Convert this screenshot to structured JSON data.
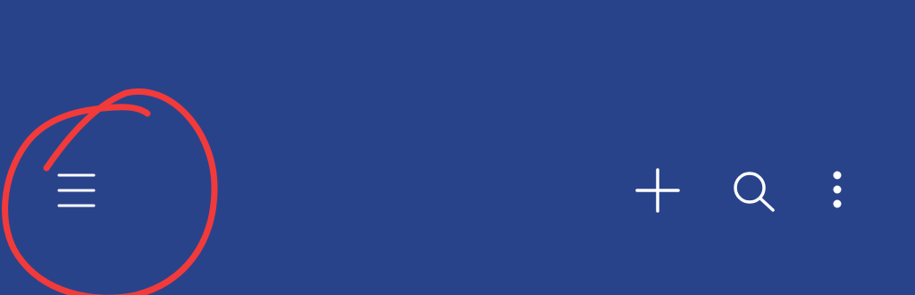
{
  "colors": {
    "app_bar_background": "#29438b",
    "icon_color": "#ffffff",
    "annotation_color": "#f23a3a"
  },
  "app_bar": {
    "leading_icon": "menu-icon",
    "actions": [
      "add-icon",
      "search-icon",
      "more-vertical-icon"
    ]
  },
  "annotation": {
    "shape": "hand-drawn circle",
    "target": "menu-button"
  }
}
